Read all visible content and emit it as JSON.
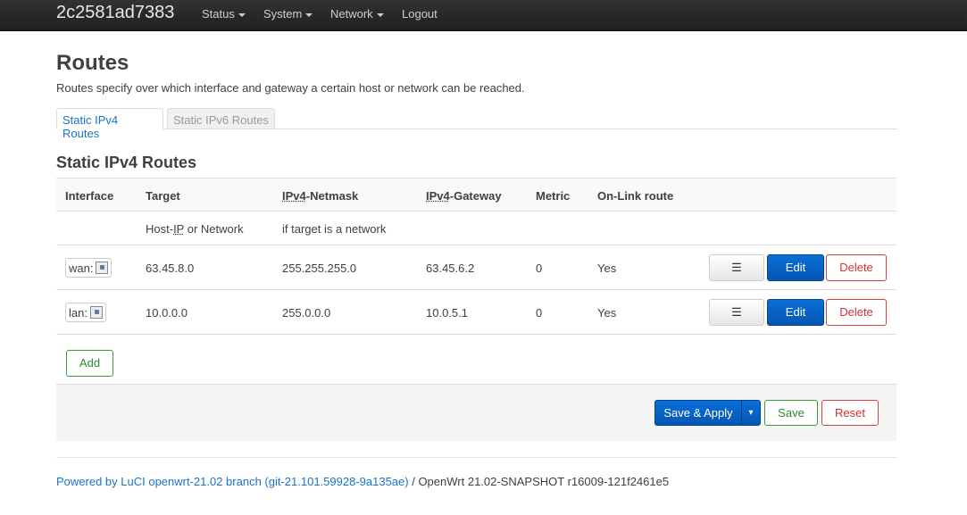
{
  "navbar": {
    "brand": "2c2581ad7383",
    "items": [
      {
        "label": "Status"
      },
      {
        "label": "System"
      },
      {
        "label": "Network"
      },
      {
        "label": "Logout"
      }
    ]
  },
  "page": {
    "title": "Routes",
    "description": "Routes specify over which interface and gateway a certain host or network can be reached."
  },
  "tabs": [
    {
      "label": "Static IPv4 Routes",
      "active": true
    },
    {
      "label": "Static IPv6 Routes",
      "active": false
    }
  ],
  "section": {
    "title": "Static IPv4 Routes",
    "columns": {
      "interface": "Interface",
      "target": "Target",
      "netmask_abbr": "IPv4",
      "netmask_rest": "-Netmask",
      "gateway_abbr": "IPv4",
      "gateway_rest": "-Gateway",
      "metric": "Metric",
      "onlink": "On-Link route"
    },
    "descriptions": {
      "target_pre": "Host-",
      "target_abbr": "IP",
      "target_post": " or Network",
      "netmask": "if target is a network"
    },
    "rows": [
      {
        "interface": "wan:",
        "target": "63.45.8.0",
        "netmask": "255.255.255.0",
        "gateway": "63.45.6.2",
        "metric": "0",
        "onlink": "Yes"
      },
      {
        "interface": "lan:",
        "target": "10.0.0.0",
        "netmask": "255.0.0.0",
        "gateway": "10.0.5.1",
        "metric": "0",
        "onlink": "Yes"
      }
    ],
    "row_buttons": {
      "more": "☰",
      "edit": "Edit",
      "delete": "Delete"
    },
    "add_label": "Add"
  },
  "actions": {
    "save_apply": "Save & Apply",
    "dropdown": "▾",
    "save": "Save",
    "reset": "Reset"
  },
  "footer": {
    "link_text": "Powered by LuCI openwrt-21.02 branch (git-21.101.59928-9a135ae)",
    "rest": " / OpenWrt 21.02-SNAPSHOT r16009-121f2461e5"
  }
}
